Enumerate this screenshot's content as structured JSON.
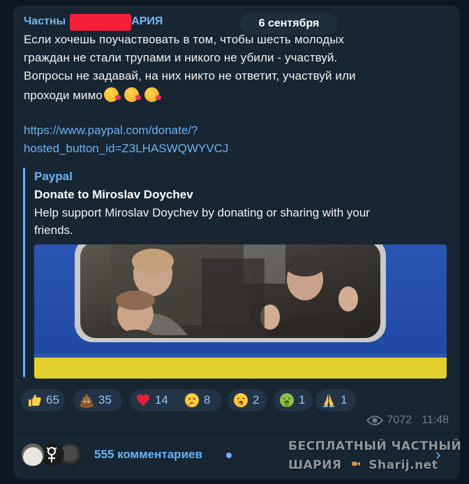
{
  "post": {
    "channel_name_start": "Частны",
    "channel_name_end": "АРИЯ",
    "date_pill": "6 сентября",
    "text_lines": [
      "Если хочешь поучаствовать в том, чтобы шесть молодых",
      "граждан не стали трупами и никого не убили - участвуй.",
      "Вопросы не задавай, на них никто не ответит, участвуй или",
      "проходи мимо"
    ],
    "link_lines": [
      "https://www.paypal.com/donate/?",
      "hosted_button_id=Z3LHASWQWYVCJ"
    ],
    "emoji_trailing": [
      "kissing-face",
      "kissing-face",
      "kissing-face"
    ]
  },
  "preview": {
    "site": "Paypal",
    "title": "Donate to Miroslav Doychev",
    "description_lines": [
      "Help support Miroslav Doychev by donating or sharing with your",
      "friends."
    ]
  },
  "reactions": [
    {
      "icon": "thumbs-up",
      "count": "65"
    },
    {
      "icon": "poop",
      "count": "35"
    },
    {
      "icon": "heart",
      "count": "14"
    },
    {
      "icon": "thinking-face",
      "count": "8"
    },
    {
      "icon": "yawning-face",
      "count": "2"
    },
    {
      "icon": "vomiting-face",
      "count": "1"
    },
    {
      "icon": "folded-hands",
      "count": "1"
    }
  ],
  "meta": {
    "views": "7072",
    "time": "11:48"
  },
  "comments": {
    "label": "555 комментариев",
    "avatars": [
      "cat-avatar",
      "symbol-avatar",
      "dark-avatar"
    ]
  },
  "watermark": {
    "line1": "БЕСПЛАТНЫЙ ЧАСТНЫЙ",
    "line2_word": "ШАРИЯ",
    "line2_site": "Sharij.net"
  },
  "colors": {
    "background": "#0e1621",
    "bubble": "#182533",
    "accent": "#6ab3f3",
    "redaction": "#f4203a"
  }
}
